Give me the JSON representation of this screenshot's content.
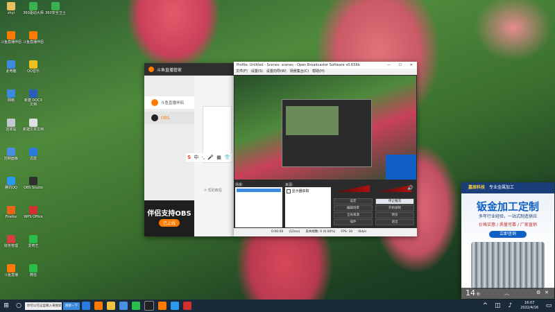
{
  "desktop": {
    "icons": [
      {
        "label": "zhyi",
        "color": "#e8c060"
      },
      {
        "label": "斗鱼直播伴侣",
        "color": "#ff7a00"
      },
      {
        "label": "此电脑",
        "color": "#3a8ae0"
      },
      {
        "label": "网络",
        "color": "#3a8ae0"
      },
      {
        "label": "回收站",
        "color": "#c0c8d0"
      },
      {
        "label": "控制面板",
        "color": "#4a90e2"
      },
      {
        "label": "腾讯QQ",
        "color": "#2a9af0"
      },
      {
        "label": "Firefox",
        "color": "#e8641a"
      },
      {
        "label": "财务管理",
        "color": "#d04040"
      },
      {
        "label": "斗鱼直播",
        "color": "#ff7a00"
      },
      {
        "label": "360驱动大师",
        "color": "#3ab050"
      },
      {
        "label": "斗鱼直播伴侣",
        "color": "#ff7a00"
      },
      {
        "label": "QQ音乐",
        "color": "#f0c020"
      },
      {
        "label": "新建 DOCX 文档",
        "color": "#2b5eb8"
      },
      {
        "label": "新建文本文档",
        "color": "#e0e0e0"
      },
      {
        "label": "迅雷",
        "color": "#2a7ae0"
      },
      {
        "label": "OBS Studio",
        "color": "#303030"
      },
      {
        "label": "WPS Office",
        "color": "#d03030"
      },
      {
        "label": "爱奇艺",
        "color": "#2bbd4a"
      },
      {
        "label": "微信",
        "color": "#2bbd4a"
      },
      {
        "label": "360安全卫士",
        "color": "#3ab050"
      }
    ]
  },
  "douyu_window": {
    "title": "斗鱼直播管家",
    "menu": [
      {
        "label": "斗鱼直播伴侣",
        "icon": "douyu-icon",
        "active": false
      },
      {
        "label": "OBS",
        "icon": "obs-icon",
        "active": true
      }
    ],
    "banner_title": "伴侣支持OBS",
    "banner_sub": "已上线",
    "link_text": "帮助教程"
  },
  "obs_window": {
    "title": "Profile: Untitled - Scenes: scenes - Open Broadcaster Software v0.659b",
    "menu": [
      "文件(F)",
      "设置(S)",
      "设置向导(W)",
      "场景集合(C)",
      "帮助(H)"
    ],
    "scenes_label": "场景:",
    "sources_label": "来源:",
    "source_item": "显示器获取",
    "buttons": {
      "settings": "设定",
      "start_stream": "停止推流",
      "edit_scene": "编辑场景",
      "start_record": "开始录制",
      "global_src": "全局来源",
      "plugins": "插件",
      "preview": "预览",
      "exit": "退出"
    },
    "status": {
      "time": "0:00:00",
      "ping": "(12ms)",
      "drop": "丢失帧数: 0 (0.00%)",
      "fps": "FPS: 30",
      "kbps": "0kb/s"
    }
  },
  "ad": {
    "company": "嘉辰科技",
    "tagline": "专业金属加工",
    "headline": "钣金加工定制",
    "sub": "多年行业经验，一站式制造供应",
    "features": "价格实惠 / 质量可靠 / 厂家直销",
    "cta": "立即咨询",
    "countdown": "14",
    "countdown_unit": "秒"
  },
  "taskbar": {
    "search_text": "你可以在这里输入来搜索",
    "task_label": "搜索一下",
    "time": "16:07",
    "date": "2022/4/16"
  },
  "colors": {
    "obs_dark": "#2b2b2b",
    "taskbar": "#1b2a3a",
    "douyu_orange": "#ff7a00",
    "ad_blue": "#0f5fc4"
  }
}
